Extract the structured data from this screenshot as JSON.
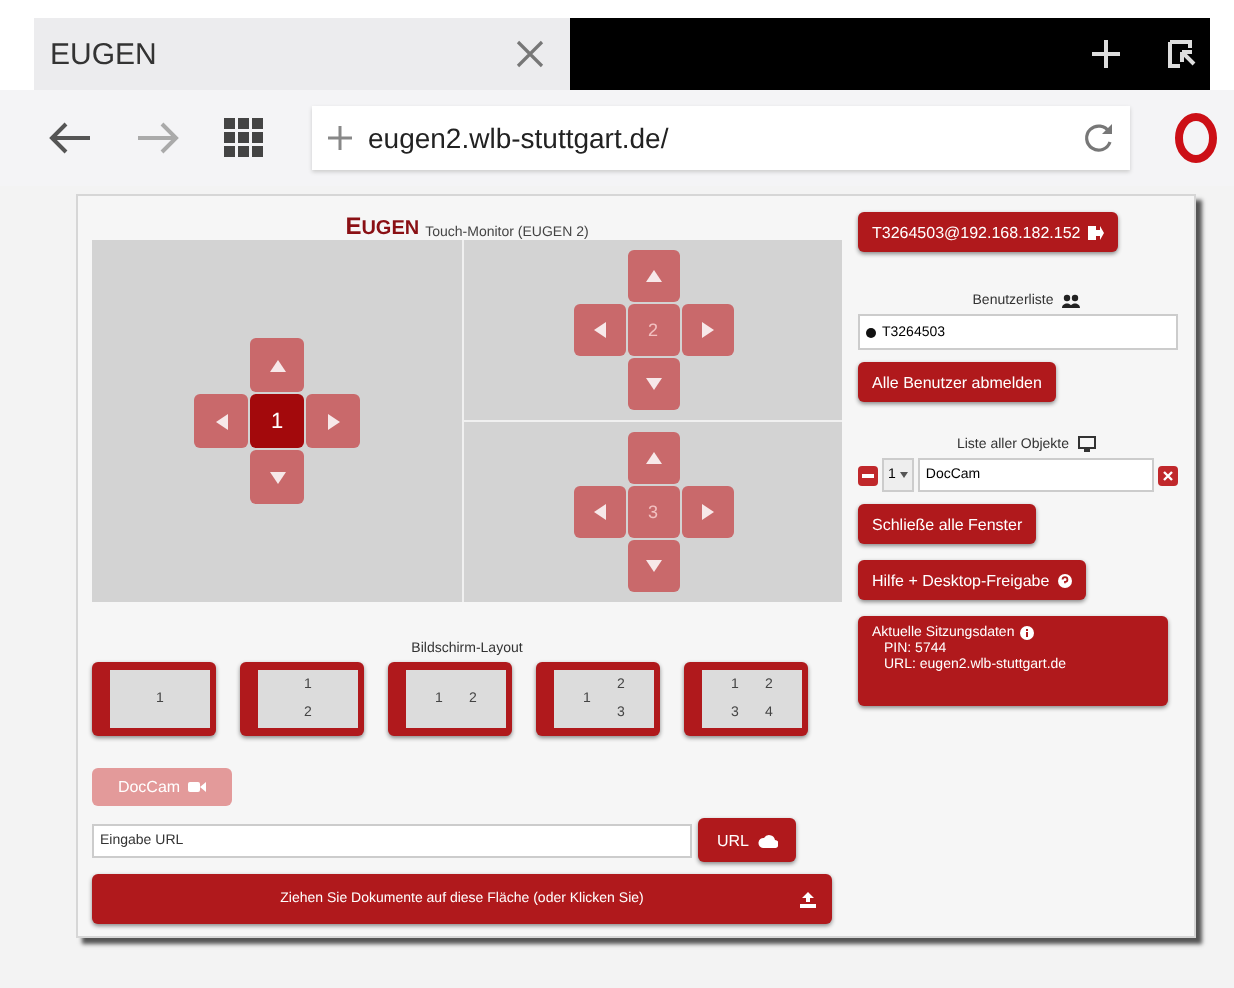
{
  "browser": {
    "tab": {
      "title": "EUGEN"
    },
    "url": "eugen2.wlb-stuttgart.de/"
  },
  "title": {
    "brand": "EUGEN",
    "subtitle": "Touch-Monitor (EUGEN 2)"
  },
  "monitors": [
    {
      "label": "1",
      "selected": true
    },
    {
      "label": "2",
      "selected": false
    },
    {
      "label": "3",
      "selected": false
    }
  ],
  "layout": {
    "heading": "Bildschirm-Layout",
    "options": [
      {
        "kind": "single",
        "cells": [
          "1"
        ]
      },
      {
        "kind": "stacked",
        "cells": [
          "1",
          "2"
        ]
      },
      {
        "kind": "side-by-side",
        "cells": [
          "1",
          "2"
        ]
      },
      {
        "kind": "split",
        "cells": [
          "1",
          "2",
          "3"
        ]
      },
      {
        "kind": "quad",
        "cells": [
          "1",
          "2",
          "3",
          "4"
        ]
      }
    ]
  },
  "doccam_button": {
    "label": "DocCam",
    "disabled": true
  },
  "url_field": {
    "placeholder": "Eingabe URL"
  },
  "url_button": "URL",
  "upload_bar": "Ziehen Sie Dokumente auf diese Fläche (oder Klicken Sie)",
  "sidebar": {
    "session_button": "T3264503@192.168.182.152",
    "users_heading": "Benutzerliste",
    "users": [
      {
        "name": "T3264503"
      }
    ],
    "logout_all_button": "Alle Benutzer abmelden",
    "objects_heading": "Liste aller Objekte",
    "objects": [
      {
        "screen": "1",
        "name": "DocCam"
      }
    ],
    "close_all_button": "Schließe alle Fenster",
    "help_button": "Hilfe + Desktop-Freigabe",
    "session_info": {
      "heading": "Aktuelle Sitzungsdaten",
      "lines": [
        "PIN: 5744",
        "URL: eugen2.wlb-stuttgart.de"
      ]
    }
  }
}
